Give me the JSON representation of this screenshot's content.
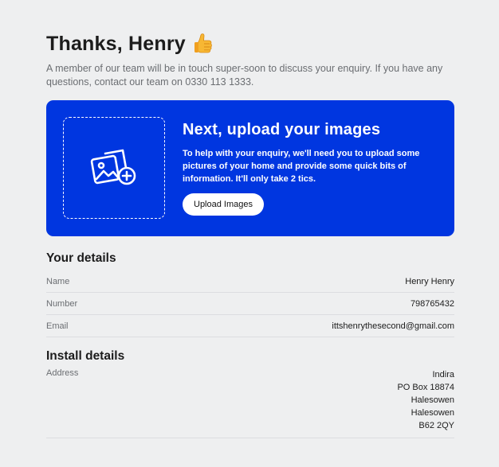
{
  "header": {
    "title": "Thanks, Henry",
    "emoji_icon": "thumbs-up-icon",
    "subtitle": "A member of our team will be in touch super-soon to discuss your enquiry. If you have any questions, contact our team on 0330 113 1333."
  },
  "upload_card": {
    "title": "Next, upload your images",
    "text": "To help with your enquiry, we'll need you to upload some pictures of your home and provide some quick bits of information. It'll only take 2 tics.",
    "button_label": "Upload Images",
    "icon": "add-image-icon",
    "background_color": "#0036e0"
  },
  "your_details": {
    "title": "Your details",
    "rows": [
      {
        "label": "Name",
        "value": "Henry Henry"
      },
      {
        "label": "Number",
        "value": "798765432"
      },
      {
        "label": "Email",
        "value": "ittshenrythesecond@gmail.com"
      }
    ]
  },
  "install_details": {
    "title": "Install details",
    "address_label": "Address",
    "address_lines": [
      "Indira",
      "PO Box 18874",
      "Halesowen",
      "Halesowen",
      "B62 2QY"
    ]
  }
}
